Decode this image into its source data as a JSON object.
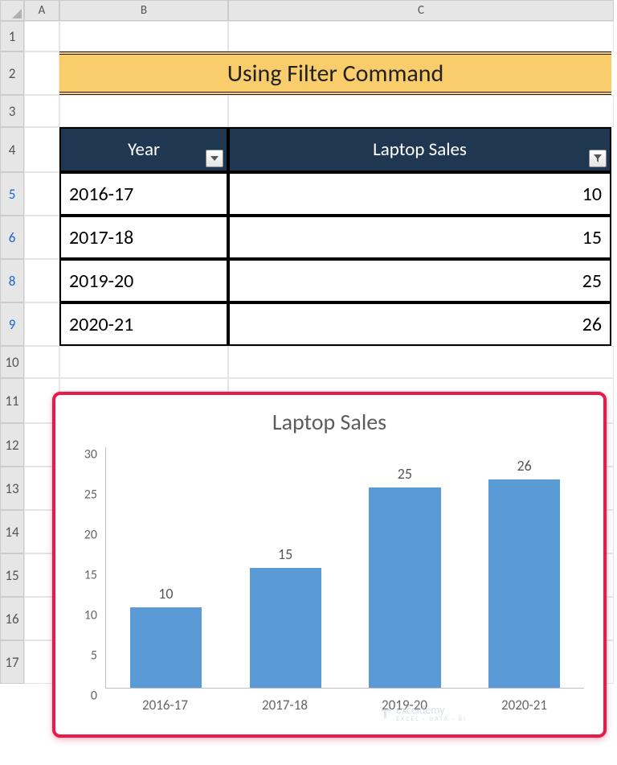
{
  "columns": [
    "A",
    "B",
    "C"
  ],
  "rows": [
    "1",
    "2",
    "3",
    "4",
    "5",
    "6",
    "8",
    "9",
    "10",
    "11",
    "12",
    "13",
    "14",
    "15",
    "16",
    "17"
  ],
  "filtered_rows": [
    5,
    6,
    8,
    9
  ],
  "title": "Using Filter Command",
  "table": {
    "headers": {
      "year": "Year",
      "sales": "Laptop Sales"
    },
    "rows": [
      {
        "year": "2016-17",
        "sales": "10"
      },
      {
        "year": "2017-18",
        "sales": "15"
      },
      {
        "year": "2019-20",
        "sales": "25"
      },
      {
        "year": "2020-21",
        "sales": "26"
      }
    ]
  },
  "chart_data": {
    "type": "bar",
    "title": "Laptop Sales",
    "categories": [
      "2016-17",
      "2017-18",
      "2019-20",
      "2020-21"
    ],
    "values": [
      10,
      15,
      25,
      26
    ],
    "xlabel": "",
    "ylabel": "",
    "ylim": [
      0,
      30
    ],
    "yticks": [
      0,
      5,
      10,
      15,
      20,
      25,
      30
    ]
  },
  "watermark": {
    "brand": "exceldemy",
    "sub": "EXCEL · DATA · BI"
  }
}
